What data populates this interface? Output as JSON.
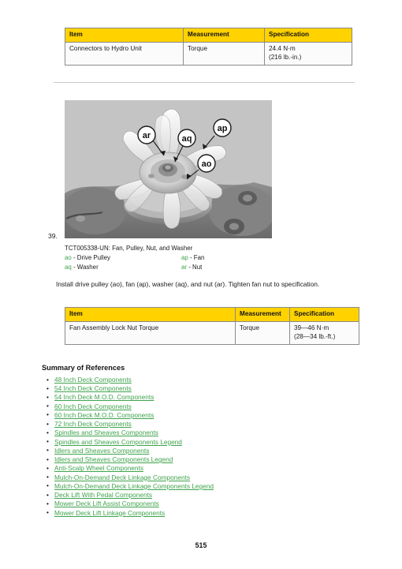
{
  "table_one": {
    "headers": [
      "Item",
      "Measurement",
      "Specification"
    ],
    "rows": [
      {
        "item": "Connectors to Hydro Unit",
        "measurement": "Torque",
        "spec_primary": "24.4 N·m",
        "spec_secondary": "(216 lb.-in.)"
      }
    ]
  },
  "figure": {
    "step_number": "39.",
    "caption": "TCT005338-UN: Fan, Pulley, Nut, and Washer",
    "callouts": [
      {
        "tag": "ao",
        "label": "Drive Pulley"
      },
      {
        "tag": "ap",
        "label": "Fan"
      },
      {
        "tag": "aq",
        "label": "Washer"
      },
      {
        "tag": "ar",
        "label": "Nut"
      }
    ],
    "legend_rows": [
      {
        "left_tag": "ao",
        "left_sep": "- Drive Pulley",
        "right_tag": "ap",
        "right_sep": "- Fan"
      },
      {
        "left_tag": "aq",
        "left_sep": "- Washer",
        "right_tag": "ar",
        "right_sep": "- Nut"
      }
    ]
  },
  "instruction": {
    "text": "Install drive pulley (ao), fan (ap), washer (aq), and nut (ar). Tighten fan nut to specification."
  },
  "table_two": {
    "headers": [
      "Item",
      "Measurement",
      "Specification"
    ],
    "rows": [
      {
        "item": "Fan Assembly Lock Nut Torque",
        "measurement": "Torque",
        "spec_primary": "39—46 N·m",
        "spec_secondary": "(28—34 lb.-ft.)"
      }
    ]
  },
  "summary": {
    "heading": "Summary of References",
    "links": [
      "48 Inch Deck Components",
      "54 Inch Deck Components",
      "54 Inch Deck M.O.D. Components",
      "60 Inch Deck Components",
      "60 Inch Deck M.O.D. Components",
      "72 Inch Deck Components",
      "Spindles and Sheaves Components",
      "Spindles and Sheaves Components Legend",
      "Idlers and Sheaves Components",
      "Idlers and Sheaves Components Legend",
      "Anti-Scalp Wheel Components",
      "Mulch-On-Demand Deck Linkage Components",
      "Mulch-On-Demand Deck Linkage Components Legend",
      "Deck Lift With Pedal Components",
      "Mower Deck Lift Assist Components",
      "Mower Deck Lift Linkage Components"
    ]
  },
  "footer": {
    "page_number": "515"
  },
  "colors": {
    "table_header": "#ffd200",
    "link_green": "#3fa34d",
    "border_gray": "#8a8a8a"
  }
}
